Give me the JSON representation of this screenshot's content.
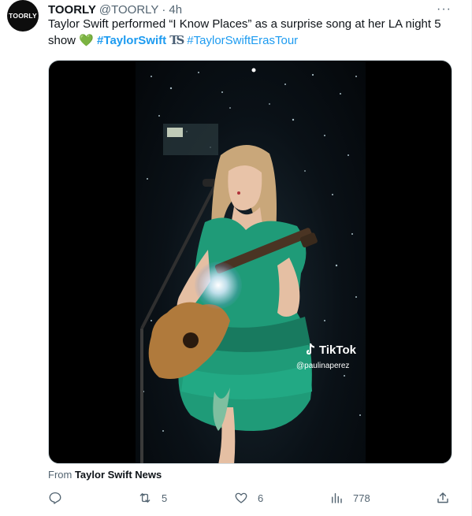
{
  "tweet": {
    "avatar_text": "TOORLY",
    "display_name": "TOORLY",
    "handle": "@TOORLY",
    "separator": "·",
    "time": "4h",
    "more_label": "···",
    "text_before": "Taylor Swift performed “I Know Places” as a surprise song at her LA night 5 show ",
    "emoji_heart": "💚",
    "hashtag_1": "#TaylorSwift",
    "hashtag_2": "#TaylorSwiftErasTour",
    "source_prefix": "From ",
    "source_name": "Taylor Swift News"
  },
  "media": {
    "watermark_brand": "TikTok",
    "watermark_handle": "@paulinaperez"
  },
  "actions": {
    "reply_count": "",
    "retweet_count": "5",
    "like_count": "6",
    "views_count": "778"
  },
  "colors": {
    "link": "#1d9bf0",
    "muted": "#536471",
    "dress": "#1f9b78"
  }
}
